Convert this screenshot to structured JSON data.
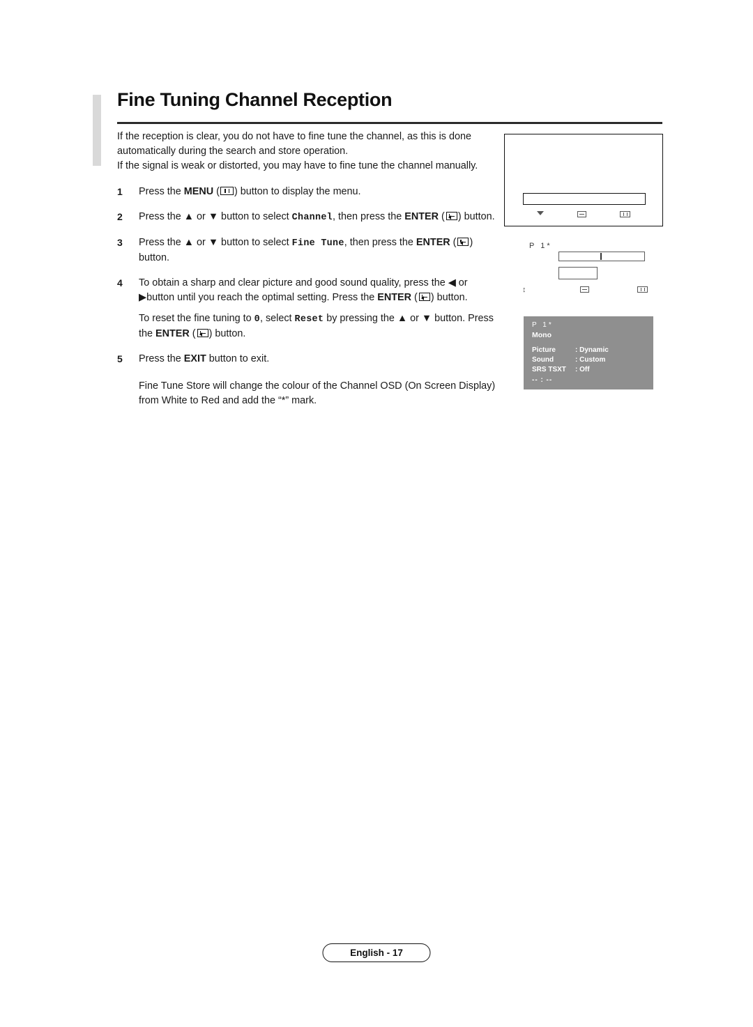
{
  "page": {
    "title": "Fine Tuning Channel Reception",
    "footer_label": "English - 17"
  },
  "intro": {
    "line1": "If the reception is clear, you do not have to fine tune the channel, as this is done",
    "line2": "automatically during the search and store operation.",
    "line3": "If the signal is weak or distorted, you may have to fine tune the channel manually."
  },
  "steps": [
    {
      "num": "1",
      "pre": "Press the ",
      "bold1": "MENU",
      "mid": " (",
      "icon": "menu-icon",
      "post": ") button to display the menu."
    },
    {
      "num": "2",
      "pre": "Press the ▲ or ▼ button to select ",
      "mono1": "Channel",
      "mid": ", then press the ",
      "bold1": "ENTER",
      "post": ") button."
    },
    {
      "num": "3",
      "pre": "Press the ▲ or ▼ button to select ",
      "mono1": "Fine  Tune",
      "mid": ", then press the ",
      "bold1": "ENTER",
      "post": ") button."
    },
    {
      "num": "4",
      "line1": "To obtain a sharp and clear picture and good sound quality, press the ◀ or ▶",
      "line2a": "button until you reach the optimal setting. Press the ",
      "bold1": "ENTER",
      "line2b": ") button."
    },
    {
      "num": "5",
      "pre": "Press the ",
      "bold1": "EXIT",
      "post": " button to exit."
    }
  ],
  "substep": {
    "line1a": "To reset the fine tuning to ",
    "mono0": "0",
    "line1b": ", select ",
    "mono1": "Reset",
    "line1c": " by pressing the ▲ or ▼",
    "line2a": "button. Press the ",
    "bold1": "ENTER",
    "line2b": ") button."
  },
  "note": {
    "line1": "Fine Tune Store will change the colour of the Channel OSD (On Screen",
    "line2": "Display) from White to Red and add the “*” mark."
  },
  "osd": {
    "figure1": {
      "icons": [
        "down-triangle-icon",
        "return-icon",
        "menu-bars-icon"
      ]
    },
    "figure2": {
      "channel_label": "P  1",
      "asterisk": "*",
      "icons": [
        "updown-icon",
        "return-icon",
        "menu-bars-icon"
      ]
    },
    "figure3": {
      "channel_label": "P  1",
      "asterisk": "*",
      "mono_label": "Mono",
      "rows": [
        {
          "key": "Picture",
          "value": ": Dynamic"
        },
        {
          "key": "Sound",
          "value": ": Custom"
        },
        {
          "key": "SRS TSXT",
          "value": ": Off"
        }
      ],
      "time": "-- : --"
    }
  }
}
